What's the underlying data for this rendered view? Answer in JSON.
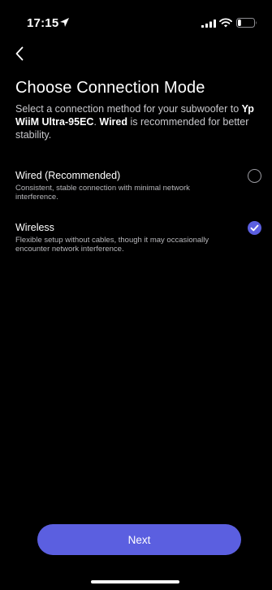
{
  "status_bar": {
    "time": "17:15",
    "battery_level": 0.2
  },
  "header": {
    "title": "Choose Connection Mode"
  },
  "description": {
    "part1": "Select a connection method for your subwoofer to ",
    "device_name": "Yp WiiM Ultra-95EC",
    "part2": ". ",
    "highlight": "Wired",
    "part3": " is recommended for better stability."
  },
  "options": [
    {
      "label": "Wired (Recommended)",
      "description": "Consistent, stable connection with minimal network interference.",
      "selected": false
    },
    {
      "label": "Wireless",
      "description": "Flexible setup without cables, though it may occasionally encounter network interference.",
      "selected": true
    }
  ],
  "footer": {
    "next_label": "Next"
  },
  "colors": {
    "accent": "#5b5fe0",
    "background": "#000000"
  },
  "icons": [
    "location-arrow-icon",
    "signal-icon",
    "wifi-icon",
    "battery-icon",
    "back-chevron-icon",
    "radio-unchecked-icon",
    "radio-checked-icon"
  ]
}
